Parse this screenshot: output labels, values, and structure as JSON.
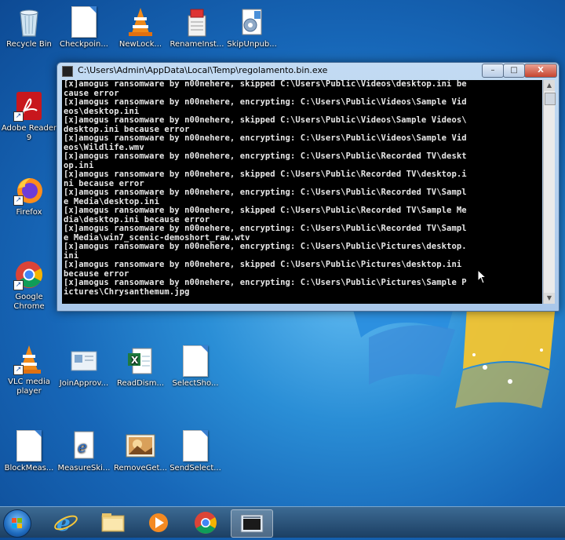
{
  "desktop_icons": {
    "recycle_bin": "Recycle Bin",
    "checkpoint": "Checkpoin...",
    "newlock": "NewLock...",
    "renameinst": "RenameInst...",
    "skipunpub": "SkipUnpub...",
    "adobe": "Adobe Reader 9",
    "firefox": "Firefox",
    "chrome": "Google Chrome",
    "vlc": "VLC media player",
    "joinapprove": "JoinApprov...",
    "readdism": "ReadDism...",
    "selectsho": "SelectSho...",
    "blockmeas": "BlockMeas...",
    "measuresk": "MeasureSki...",
    "removeget": "RemoveGet...",
    "sendselect": "SendSelect..."
  },
  "console": {
    "title": "C:\\Users\\Admin\\AppData\\Local\\Temp\\regolamento.bin.exe",
    "minimize": "–",
    "maximize": "□",
    "close": "X",
    "lines": [
      "[x]amogus ransomware by n00nehere, skipped C:\\Users\\Public\\Videos\\desktop.ini be",
      "cause error",
      "[x]amogus ransomware by n00nehere, encrypting: C:\\Users\\Public\\Videos\\Sample Vid",
      "eos\\desktop.ini",
      "[x]amogus ransomware by n00nehere, skipped C:\\Users\\Public\\Videos\\Sample Videos\\",
      "desktop.ini because error",
      "[x]amogus ransomware by n00nehere, encrypting: C:\\Users\\Public\\Videos\\Sample Vid",
      "eos\\Wildlife.wmv",
      "[x]amogus ransomware by n00nehere, encrypting: C:\\Users\\Public\\Recorded TV\\deskt",
      "op.ini",
      "[x]amogus ransomware by n00nehere, skipped C:\\Users\\Public\\Recorded TV\\desktop.i",
      "ni because error",
      "[x]amogus ransomware by n00nehere, encrypting: C:\\Users\\Public\\Recorded TV\\Sampl",
      "e Media\\desktop.ini",
      "[x]amogus ransomware by n00nehere, skipped C:\\Users\\Public\\Recorded TV\\Sample Me",
      "dia\\desktop.ini because error",
      "[x]amogus ransomware by n00nehere, encrypting: C:\\Users\\Public\\Recorded TV\\Sampl",
      "e Media\\win7_scenic-demoshort_raw.wtv",
      "[x]amogus ransomware by n00nehere, encrypting: C:\\Users\\Public\\Pictures\\desktop.",
      "ini",
      "[x]amogus ransomware by n00nehere, skipped C:\\Users\\Public\\Pictures\\desktop.ini",
      "because error",
      "[x]amogus ransomware by n00nehere, encrypting: C:\\Users\\Public\\Pictures\\Sample P",
      "ictures\\Chrysanthemum.jpg"
    ]
  },
  "taskbar": {
    "items": [
      "Start",
      "Internet Explorer",
      "Windows Explorer",
      "Windows Media Player",
      "Google Chrome",
      "regolamento.bin.exe"
    ]
  },
  "colors": {
    "console_bg": "#000000",
    "console_text": "#e8e8e8",
    "taskbar": "#1c3f63",
    "close_button": "#c7452f"
  }
}
